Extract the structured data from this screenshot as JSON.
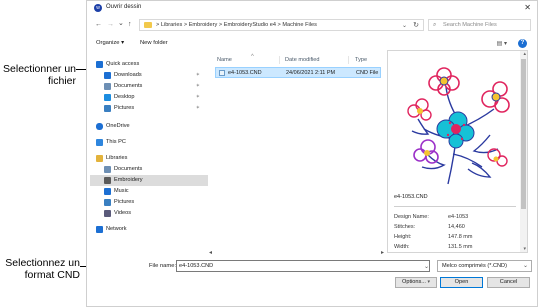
{
  "callouts": {
    "select_file": "Selectionner un fichier",
    "select_format": "Selectionnez un format CND"
  },
  "window": {
    "title": "Ouvrir dessin",
    "app_icon": "wilcom-icon",
    "close_glyph": "✕"
  },
  "address_bar": {
    "back_glyph": "←",
    "forward_glyph": "→",
    "recent_glyph": "⌄",
    "up_glyph": "↑",
    "breadcrumbs": [
      "Libraries",
      "Embroidery",
      "EmbroideryStudio e4",
      "Machine Files"
    ],
    "separator": ">",
    "dropdown_glyph": "⌄",
    "refresh_glyph": "↻",
    "search_placeholder": "Search Machine Files",
    "search_glyph": "⌕"
  },
  "toolbar": {
    "organize": "Organize ▾",
    "new_folder": "New folder",
    "view_glyph": "▤ ▾",
    "help_glyph": "?"
  },
  "nav": {
    "items": [
      {
        "label": "Quick access",
        "icon": "star-icon",
        "color": "#1c6fd3",
        "pinned": false
      },
      {
        "label": "Downloads",
        "icon": "download-icon",
        "color": "#1c6fd3",
        "pinned": true
      },
      {
        "label": "Documents",
        "icon": "documents-icon",
        "color": "#6d8fb4",
        "pinned": true
      },
      {
        "label": "Desktop",
        "icon": "desktop-icon",
        "color": "#1c8de0",
        "pinned": true
      },
      {
        "label": "Pictures",
        "icon": "pictures-icon",
        "color": "#3a7fc1",
        "pinned": true
      },
      {
        "label": "OneDrive",
        "icon": "cloud-icon",
        "color": "#1c6fd3",
        "pinned": false
      },
      {
        "label": "This PC",
        "icon": "computer-icon",
        "color": "#2e86de",
        "pinned": false
      },
      {
        "label": "Libraries",
        "icon": "libraries-icon",
        "color": "#e3b33c",
        "pinned": false
      },
      {
        "label": "Documents",
        "icon": "documents-icon",
        "color": "#6d8fb4",
        "pinned": false
      },
      {
        "label": "Embroidery",
        "icon": "embroidery-icon",
        "color": "#5a5a5a",
        "pinned": false
      },
      {
        "label": "Music",
        "icon": "music-icon",
        "color": "#1c6fd3",
        "pinned": false
      },
      {
        "label": "Pictures",
        "icon": "pictures-icon",
        "color": "#3a7fc1",
        "pinned": false
      },
      {
        "label": "Videos",
        "icon": "videos-icon",
        "color": "#5a5a7a",
        "pinned": false
      },
      {
        "label": "Network",
        "icon": "network-icon",
        "color": "#1c6fd3",
        "pinned": false
      }
    ],
    "pin_glyph": "✶"
  },
  "files": {
    "columns": [
      "Name",
      "Date modified",
      "Type"
    ],
    "sort_glyph": "^",
    "rows": [
      {
        "name": "e4-1053.CND",
        "date": "24/06/2021 2:11 PM",
        "type": "CND File"
      }
    ]
  },
  "scroll": {
    "left_glyph": "◂",
    "right_glyph": "▸",
    "up_glyph": "▴",
    "down_glyph": "▾"
  },
  "preview": {
    "filename": "e4-1053.CND",
    "props": [
      {
        "label": "Design Name:",
        "value": "e4-1053"
      },
      {
        "label": "Stitches:",
        "value": "14,460"
      },
      {
        "label": "Height:",
        "value": "147.8 mm"
      },
      {
        "label": "Width:",
        "value": "131.5 mm"
      }
    ]
  },
  "bottom": {
    "file_name_label": "File name:",
    "file_name_value": "e4-1053.CND",
    "dropdown_glyph": "⌄",
    "file_type": "Melco comprimés (*.CND)",
    "options": "Options...",
    "open": "Open",
    "cancel": "Cancel",
    "options_dd": "▾"
  }
}
